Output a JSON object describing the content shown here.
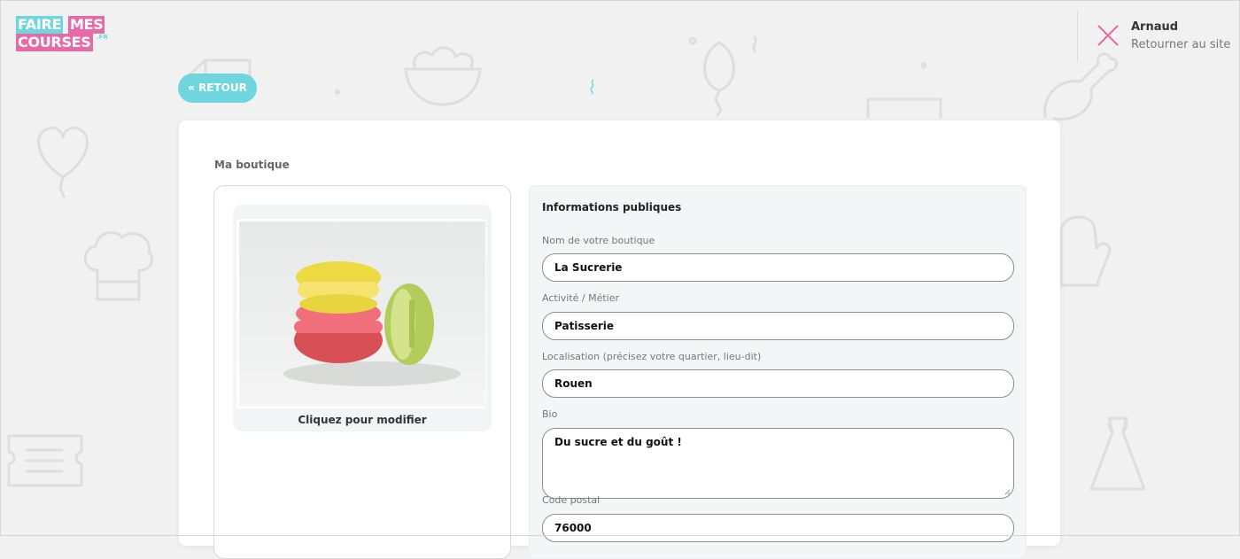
{
  "logo": {
    "word1": "FAIRE",
    "word2": "MES",
    "word3": "COURSES",
    "suffix": ".FR"
  },
  "user": {
    "name": "Arnaud",
    "return_link": "Retourner au site"
  },
  "back_button": {
    "label": "« RETOUR"
  },
  "page": {
    "section_title": "Ma boutique"
  },
  "image_panel": {
    "caption": "Cliquez pour modifier"
  },
  "info": {
    "title": "Informations publiques",
    "fields": [
      {
        "label": "Nom de votre boutique",
        "value": "La Sucrerie"
      },
      {
        "label": "Activité / Métier",
        "value": "Patisserie"
      },
      {
        "label": "Localisation (précisez votre quartier, lieu-dit)",
        "value": "Rouen"
      },
      {
        "label": "Bio",
        "value": "Du sucre et du goût !"
      },
      {
        "label": "Code postal",
        "value": "76000"
      }
    ]
  },
  "colors": {
    "accent_cyan": "#6fd6df",
    "accent_pink": "#e66aa8",
    "background": "#f1f1f1"
  }
}
